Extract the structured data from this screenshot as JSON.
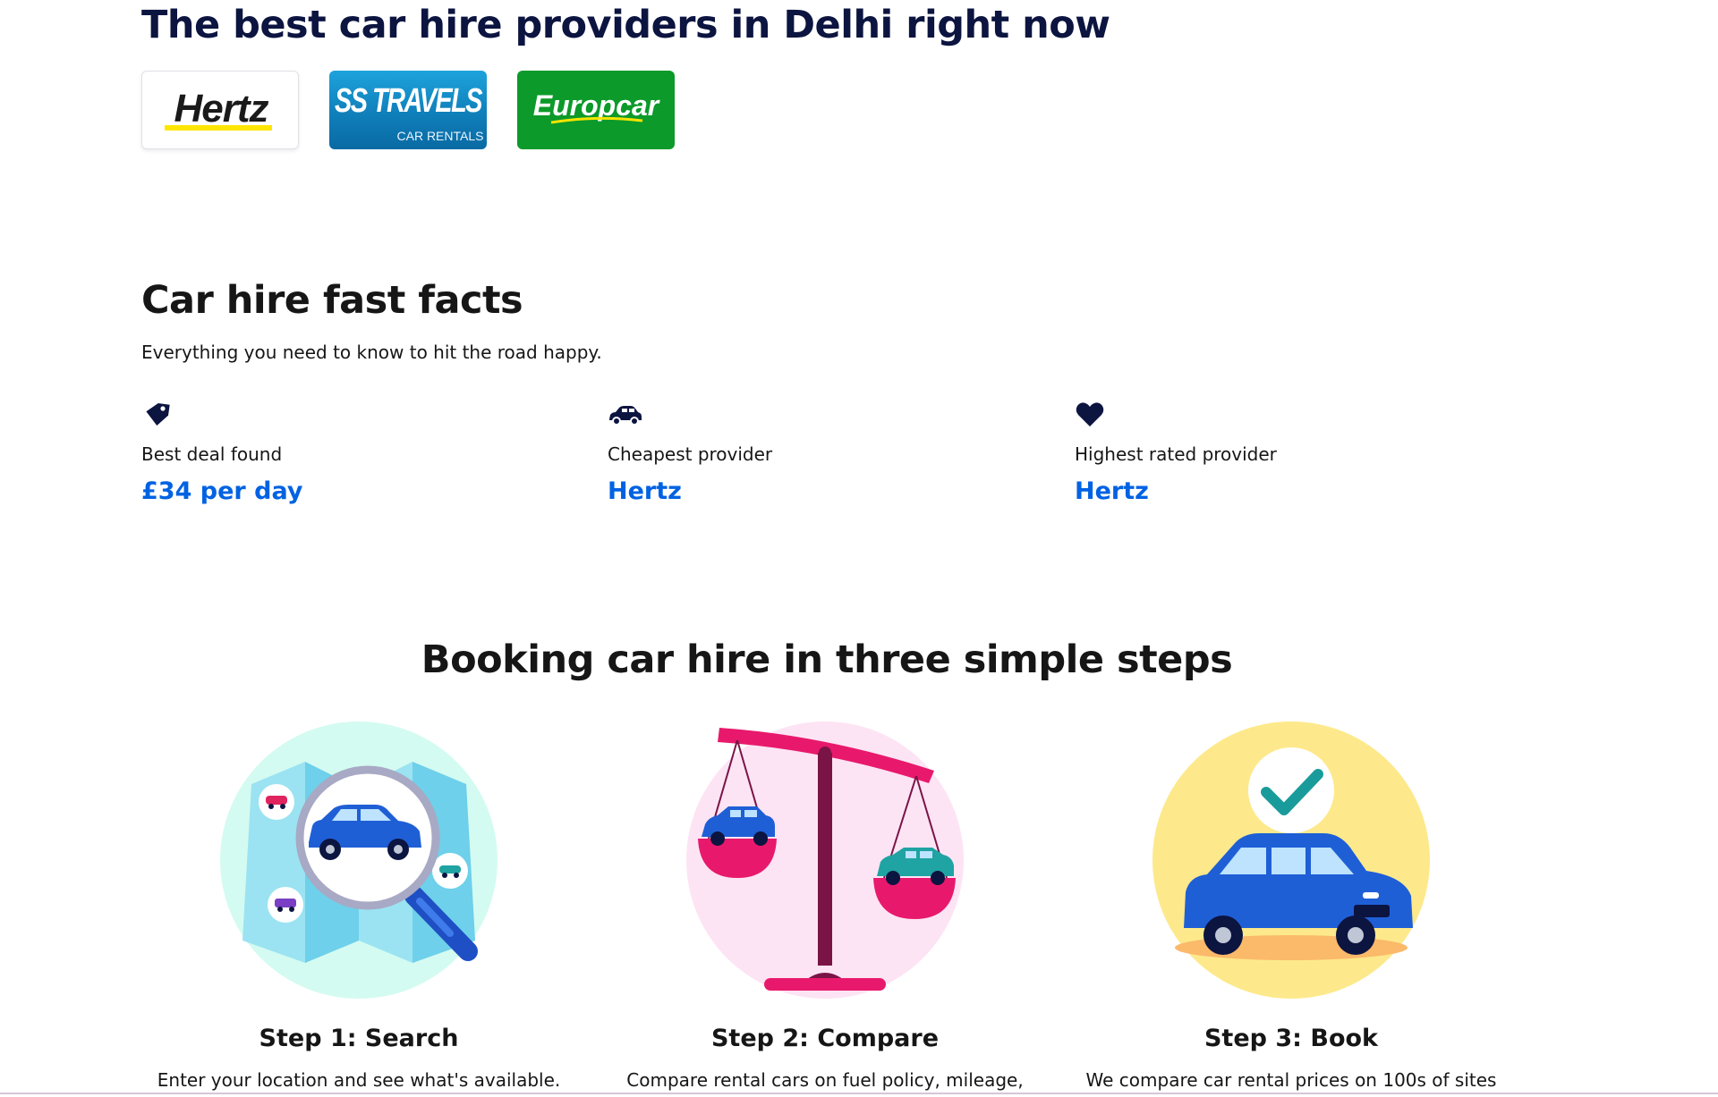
{
  "providers": {
    "title": "The best car hire providers in Delhi right now",
    "logos": [
      {
        "name": "Hertz",
        "wordmark": "Hertz",
        "bg_color": "#ffffff",
        "accent_color": "#ffe600"
      },
      {
        "name": "SS Travels",
        "wordmark": "SS TRAVELS",
        "sub_wordmark": "CAR RENTALS",
        "bg_color": "#1a8fcc"
      },
      {
        "name": "Europcar",
        "wordmark": "Europcar",
        "bg_color": "#0c9a2a",
        "accent_color": "#f5e400"
      }
    ]
  },
  "fast_facts": {
    "title": "Car hire fast facts",
    "subtitle": "Everything you need to know to hit the road happy.",
    "items": [
      {
        "icon": "price-tag-icon",
        "label": "Best deal found",
        "value": "£34 per day"
      },
      {
        "icon": "car-icon",
        "label": "Cheapest provider",
        "value": "Hertz"
      },
      {
        "icon": "heart-icon",
        "label": "Highest rated provider",
        "value": "Hertz"
      }
    ]
  },
  "steps": {
    "title": "Booking car hire in three simple steps",
    "items": [
      {
        "illustration": "map-magnifier-illustration",
        "title": "Step 1: Search",
        "text": "Enter your location and see what's available."
      },
      {
        "illustration": "scales-illustration",
        "title": "Step 2: Compare",
        "text": "Compare rental cars on fuel policy, mileage,"
      },
      {
        "illustration": "car-check-illustration",
        "title": "Step 3: Book",
        "text": "We compare car rental prices on 100s of sites"
      }
    ]
  },
  "colors": {
    "brand_dark": "#0c1440",
    "link_blue": "#0062e3",
    "text": "#161616"
  }
}
